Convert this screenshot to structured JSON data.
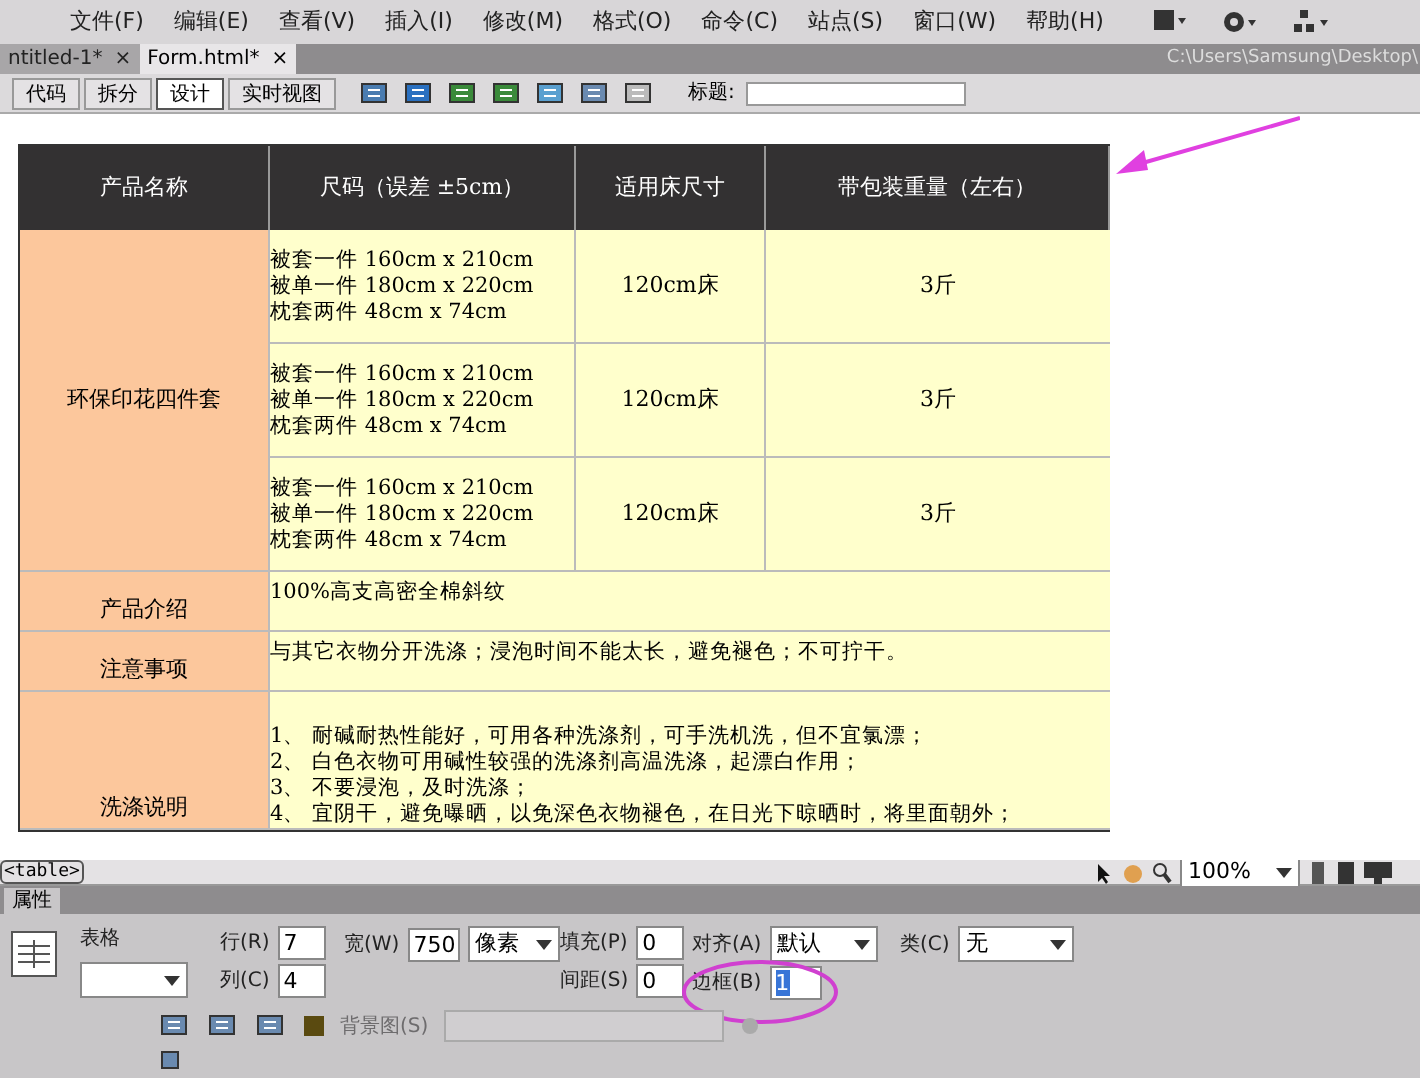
{
  "menu": [
    "文件(F)",
    "编辑(E)",
    "查看(V)",
    "插入(I)",
    "修改(M)",
    "格式(O)",
    "命令(C)",
    "站点(S)",
    "窗口(W)",
    "帮助(H)"
  ],
  "tabs": [
    {
      "label": "ntitled-1*",
      "selected": false
    },
    {
      "label": "Form.html*",
      "selected": true
    }
  ],
  "close_glyph": "×",
  "file_path": "C:\\Users\\Samsung\\Desktop\\",
  "view_buttons": [
    {
      "label": "代码",
      "selected": false
    },
    {
      "label": "拆分",
      "selected": false
    },
    {
      "label": "设计",
      "selected": true
    },
    {
      "label": "实时视图",
      "selected": false
    }
  ],
  "title_label": "标题:",
  "table": {
    "columns": [
      "产品名称",
      "尺码（误差 ±5cm）",
      "适用床尺寸",
      "带包装重量（左右）"
    ],
    "product": "环保印花四件套",
    "sizes": [
      {
        "lines": [
          "被套一件 160cm x 210cm",
          "被单一件 180cm x 220cm",
          "枕套两件 48cm x 74cm"
        ],
        "bed": "120cm床",
        "weight": "3斤"
      },
      {
        "lines": [
          "被套一件 160cm x 210cm",
          "被单一件 180cm x 220cm",
          "枕套两件 48cm x 74cm"
        ],
        "bed": "120cm床",
        "weight": "3斤"
      },
      {
        "lines": [
          "被套一件 160cm x 210cm",
          "被单一件 180cm x 220cm",
          "枕套两件 48cm x 74cm"
        ],
        "bed": "120cm床",
        "weight": "3斤"
      }
    ],
    "details": [
      {
        "label": "产品介绍",
        "lines": [
          "100%高支高密全棉斜纹"
        ]
      },
      {
        "label": "注意事项",
        "lines": [
          "与其它衣物分开洗涤；浸泡时间不能太长，避免褪色；不可拧干。"
        ]
      },
      {
        "label": "洗涤说明",
        "lines": [
          "1、 耐碱耐热性能好，可用各种洗涤剂，可手洗机洗，但不宜氯漂；",
          "2、 白色衣物可用碱性较强的洗涤剂高温洗涤，起漂白作用；",
          "3、 不要浸泡，及时洗涤；",
          "4、 宜阴干，避免曝晒，以免深色衣物褪色，在日光下晾晒时，将里面朝外；"
        ]
      }
    ]
  },
  "tag_selector": "<table>",
  "zoom": "100%",
  "properties": {
    "tab": "属性",
    "type": "表格",
    "rows": {
      "label": "行(R)",
      "value": "7"
    },
    "cols": {
      "label": "列(C)",
      "value": "4"
    },
    "width": {
      "label": "宽(W)",
      "value": "750",
      "unit": "像素"
    },
    "padding": {
      "label": "填充(P)",
      "value": "0"
    },
    "spacing": {
      "label": "间距(S)",
      "value": "0"
    },
    "align": {
      "label": "对齐(A)",
      "value": "默认"
    },
    "border": {
      "label": "边框(B)",
      "value": "1"
    },
    "class": {
      "label": "类(C)",
      "value": "无"
    },
    "bg_image": {
      "label": "背景图(S)",
      "disabled": true
    }
  }
}
